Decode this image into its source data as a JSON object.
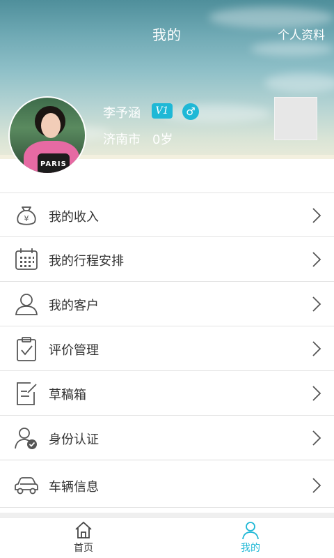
{
  "header": {
    "title": "我的",
    "profile_link": "个人资料"
  },
  "user": {
    "name": "李予涵",
    "vip_level": "V1",
    "gender_symbol": "♂",
    "city": "济南市",
    "age": "0岁",
    "avatar_text": "PARIS"
  },
  "menu": {
    "items": [
      {
        "label": "我的收入",
        "icon": "income-bag-icon"
      },
      {
        "label": "我的行程安排",
        "icon": "calendar-icon"
      },
      {
        "label": "我的客户",
        "icon": "user-icon"
      },
      {
        "label": "评价管理",
        "icon": "clipboard-check-icon"
      },
      {
        "label": "草稿箱",
        "icon": "draft-edit-icon"
      },
      {
        "label": "身份认证",
        "icon": "user-verified-icon"
      },
      {
        "label": "车辆信息",
        "icon": "car-icon"
      }
    ]
  },
  "tabbar": {
    "tabs": [
      {
        "label": "首页",
        "icon": "home-icon",
        "active": false
      },
      {
        "label": "我的",
        "icon": "person-icon",
        "active": true
      }
    ]
  },
  "colors": {
    "accent": "#1fb8d6",
    "text": "#333333",
    "divider": "#e3e3e3"
  }
}
